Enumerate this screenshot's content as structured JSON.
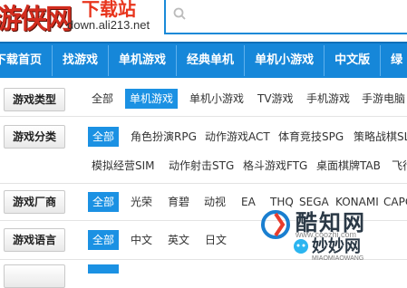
{
  "header": {
    "logo_chars": "游侠网",
    "logo_sub": "下载站",
    "logo_url": "down.ali213.net"
  },
  "nav": {
    "items": [
      "下载首页",
      "找游戏",
      "单机游戏",
      "经典单机",
      "单机小游戏",
      "中文版",
      "绿"
    ]
  },
  "filters": {
    "type": {
      "label": "游戏类型",
      "options": [
        "全部",
        "单机游戏",
        "单机小游戏",
        "TV游戏",
        "手机游戏",
        "手游电脑"
      ],
      "selected": "单机游戏"
    },
    "category": {
      "label": "游戏分类",
      "options_line1": [
        "全部",
        "角色扮演RPG",
        "动作游戏ACT",
        "体育竞技SPG",
        "策略战棋SL"
      ],
      "options_line2": [
        "模拟经营SIM",
        "动作射击STG",
        "格斗游戏FTG",
        "桌面棋牌TAB",
        "飞行"
      ],
      "selected": "全部"
    },
    "maker": {
      "label": "游戏厂商",
      "options": [
        "全部",
        "光荣",
        "育碧",
        "动视",
        "EA",
        "THQ",
        "SEGA",
        "KONAMI",
        "CAPC"
      ],
      "selected": "全部"
    },
    "language": {
      "label": "游戏语言",
      "options": [
        "全部",
        "中文",
        "英文",
        "日文"
      ],
      "selected": "全部"
    }
  },
  "watermark": {
    "text1": "酷知网",
    "sub1": "www.coozhi.com",
    "text2": "妙妙网",
    "sub2": "MIAOMIAOWANG"
  },
  "colors": {
    "nav_bg": "#1687d9",
    "selected_bg": "#1b91e3",
    "logo_red": "#d22c1e"
  }
}
